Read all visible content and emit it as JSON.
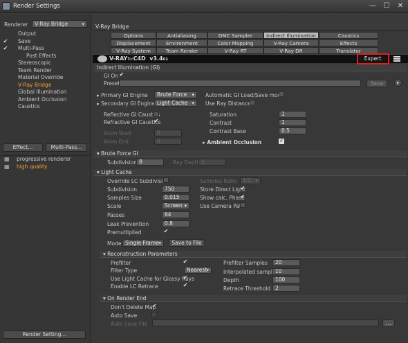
{
  "window": {
    "title": "Render Settings",
    "controls": [
      "—",
      "☐",
      "✕"
    ]
  },
  "left": {
    "renderer_label": "Renderer",
    "renderer_value": "V-Ray Bridge",
    "tree": [
      {
        "label": "Output",
        "checked": false,
        "indent": 1
      },
      {
        "label": "Save",
        "checked": true,
        "indent": 1
      },
      {
        "label": "Multi-Pass",
        "checked": true,
        "indent": 1,
        "tri": true
      },
      {
        "label": "Post Effects",
        "checked": false,
        "indent": 2
      },
      {
        "label": "Stereoscopic",
        "checked": false,
        "indent": 1
      },
      {
        "label": "Team Render",
        "checked": false,
        "indent": 1
      },
      {
        "label": "Material Override",
        "checked": false,
        "indent": 1
      },
      {
        "label": "V-Ray Bridge",
        "checked": false,
        "indent": 1,
        "selected": true
      },
      {
        "label": "Global Illumination",
        "checked": false,
        "indent": 1
      },
      {
        "label": "Ambient Occlusion",
        "checked": false,
        "indent": 1
      },
      {
        "label": "Caustics",
        "checked": false,
        "indent": 1
      }
    ],
    "effect_btn": "Effect...",
    "multipass_btn": "Multi-Pass...",
    "presets": [
      {
        "label": "progressive renderer",
        "selected": false
      },
      {
        "label": "high quality",
        "selected": true
      }
    ],
    "render_setting_btn": "Render Setting..."
  },
  "main": {
    "header": "V-Ray Bridge",
    "tabs_row1": [
      "Options",
      "Antialiasing",
      "DMC Sampler",
      "Indirect Illumination (GI)",
      "Caustics"
    ],
    "tabs_row2": [
      "Displacement",
      "Environment",
      "Color Mapping",
      "V-Ray Camera",
      "Effects"
    ],
    "tabs_row3": [
      "V-Ray System",
      "Team Render",
      "V-Ray RT",
      "V-Ray DR",
      "Translator"
    ],
    "active_tab": "Indirect Illumination (GI)",
    "logo_text": "V-RAY",
    "logo_for": "for",
    "logo_c4d": "C4D",
    "version": "v3.4",
    "version_sub": "01",
    "expert": "Expert",
    "section_gi": "Indirect Illumination (GI)",
    "gi_on": "GI On",
    "preset": "Preset",
    "save_btn": "Save",
    "primary_engine": "Primary GI Engine",
    "primary_value": "Brute Force",
    "secondary_engine": "Secondary GI Engine",
    "secondary_value": "Light Cache",
    "refl_caustics": "Reflective GI Caustics",
    "refr_caustics": "Refractive GI Caustics",
    "anim_start": "Anim Start",
    "anim_start_val": "0",
    "anim_end": "Anim End",
    "anim_end_val": "0",
    "auto_gi": "Automatic GI Load/Save mode",
    "use_ray": "Use Ray Distance",
    "saturation": "Saturation",
    "saturation_val": "1",
    "contrast": "Contrast",
    "contrast_val": "1",
    "contrast_base": "Contrast Base",
    "contrast_base_val": "0.5",
    "ambient_occlusion": "Ambient Occlusion",
    "section_bf": "Brute Force GI",
    "subdivision": "Subdivision",
    "subdivision_val": "8",
    "ray_depth": "Ray Depth",
    "ray_depth_val": "3",
    "section_lc": "Light Cache",
    "override_lc": "Override LC Subdivision",
    "lc_subdivision": "Subdivision",
    "lc_subdivision_val": "750",
    "samples_size": "Samples Size",
    "samples_size_val": "0.015",
    "scale": "Scale",
    "scale_val": "Screen",
    "passes": "Passes",
    "passes_val": "64",
    "leak": "Leak Prevention",
    "leak_val": "0.8",
    "premultiplied": "Premultiplied",
    "mode": "Mode",
    "mode_val": "Single Frame",
    "save_to_file": "Save to File",
    "samples_ratio": "Samples Ratio",
    "samples_ratio_val": "1/2",
    "store_direct": "Store Direct Light",
    "show_calc": "Show calc. Phase",
    "use_camera": "Use Camera Path",
    "section_recon": "Reconstruction Parameters",
    "prefilter": "Prefilter",
    "filter_type": "Filter Type",
    "filter_val": "Nearest",
    "use_lc_glossy": "Use Light Cache for Glossy Rays",
    "enable_lc": "Enable LC Retrace",
    "prefilter_samples": "Prefilter Samples",
    "prefilter_samples_val": "20",
    "interp_samples": "Interpolated samples",
    "interp_samples_val": "10",
    "depth": "Depth",
    "depth_val": "100",
    "retrace": "Retrace Threshold",
    "retrace_val": "2",
    "section_ore": "On Render End",
    "dont_delete": "Don't Delete Map",
    "auto_save": "Auto Save",
    "auto_save_file": "Auto Save File"
  },
  "colors": {
    "accent": "#f2a22e",
    "highlight": "#e0201c",
    "tab_active": "#bdbdbd"
  }
}
